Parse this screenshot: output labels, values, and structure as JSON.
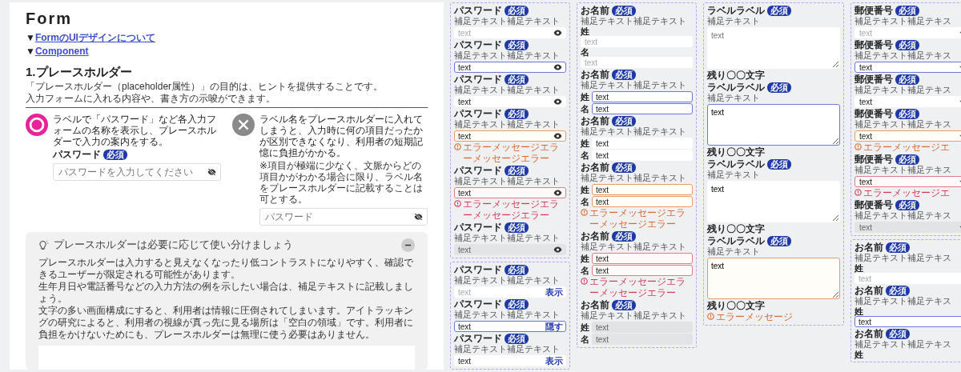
{
  "doc": {
    "title": "Form",
    "links": [
      {
        "marker": "▼",
        "label": "FormのUIデザインについて"
      },
      {
        "marker": "▼",
        "label": "Component"
      }
    ],
    "section_title": "1.プレースホルダー",
    "intro": [
      "「プレースホルダー（placeholder属性）」の目的は、ヒントを提供することです。",
      "入力フォームに入れる内容や、書き方の示唆ができます。"
    ],
    "examples": [
      {
        "kind": "good",
        "text": "ラベルで「パスワード」など各入力フォームの名称を表示し、プレースホルダーで入力の案内をする。",
        "field": {
          "label": "パスワード",
          "badge": "必須",
          "placeholder": "パスワードを入力してください"
        }
      },
      {
        "kind": "bad",
        "text": "ラベル名をプレースホルダーに入れてしまうと、入力時に何の項目だったかが区別できなくなり、利用者の短期記憶に負担がかかる。",
        "note": "※項目が極端に少なく、文脈からどの項目かがわかる場合に限り、ラベル名をプレースホルダーに記載することは可とする。",
        "field": {
          "placeholder": "パスワード"
        }
      }
    ],
    "tip": {
      "title": "プレースホルダーは必要に応じて使い分けましょう",
      "expanded": true,
      "paragraphs": [
        "プレースホルダーは入力すると見えなくなったり低コントラストになりやすく、確認できるユーザーが限定される可能性があります。",
        "生年月日や電話番号などの入力方法の例を示したい場合は、補足テキストに記載しましょう。",
        "文字の多い画面構成にすると、利用者は情報に圧倒されてしまいます。アイトラッキングの研究によると、利用者の視線が真っ先に見る場所は「空白の領域」です。利用者に負担をかけないためにも、プレースホルダーは無理に使う必要はありません。"
      ]
    }
  },
  "columns": [
    {
      "frames": [
        {
          "kind": "password",
          "items": [
            {
              "label": "パスワード",
              "badge": "必須",
              "help": "補足テキスト補足テキスト",
              "focused": false,
              "warning": false,
              "error": false,
              "disabled": false,
              "placeholder": "text"
            },
            {
              "label": "パスワード",
              "badge": "必須",
              "help": "補足テキスト補足テキスト",
              "focused": true,
              "warning": false,
              "error": false,
              "disabled": false,
              "value": "text"
            },
            {
              "label": "パスワード",
              "badge": "必須",
              "help": "補足テキスト補足テキスト",
              "focused": false,
              "warning": false,
              "error": false,
              "disabled": false,
              "value": "text"
            },
            {
              "label": "パスワード",
              "badge": "必須",
              "help": "補足テキスト補足テキスト",
              "focused": false,
              "warning": true,
              "error": false,
              "disabled": false,
              "value": "text",
              "message": "エラーメッセージエラーメッセージエラー"
            },
            {
              "label": "パスワード",
              "badge": "必須",
              "help": "補足テキスト補足テキスト",
              "focused": false,
              "warning": false,
              "error": true,
              "disabled": false,
              "value": "text",
              "message": "エラーメッセージエラーメッセージエラー"
            },
            {
              "label": "パスワード",
              "badge": "必須",
              "help": "補足テキスト補足テキスト",
              "focused": false,
              "warning": false,
              "error": false,
              "disabled": true,
              "value": "text"
            }
          ]
        },
        {
          "kind": "password_toggle",
          "items": [
            {
              "label": "パスワード",
              "badge": "必須",
              "help": "補足テキスト補足テキスト",
              "focused": false,
              "warning": false,
              "error": false,
              "disabled": false,
              "placeholder": "text",
              "toggle": "表示"
            },
            {
              "label": "パスワード",
              "badge": "必須",
              "help": "補足テキスト補足テキスト",
              "focused": true,
              "warning": false,
              "error": false,
              "disabled": false,
              "value": "text",
              "toggle": "隠す"
            },
            {
              "label": "パスワード",
              "badge": "必須",
              "help": "補足テキスト補足テキスト",
              "focused": false,
              "warning": false,
              "error": false,
              "disabled": false,
              "value": "text",
              "toggle": "表示"
            }
          ]
        }
      ]
    },
    {
      "frames": [
        {
          "kind": "name",
          "items": [
            {
              "label": "お名前",
              "badge": "必須",
              "help": "補足テキスト補足テキスト",
              "focused": false,
              "warning": false,
              "error": false,
              "disabled": false,
              "labels_on_top": true,
              "parts": [
                {
                  "label": "姓",
                  "placeholder": "text"
                },
                {
                  "label": "名",
                  "placeholder": "text"
                }
              ]
            },
            {
              "label": "お名前",
              "badge": "必須",
              "help": "補足テキスト補足テキスト",
              "focused": true,
              "warning": false,
              "error": false,
              "disabled": false,
              "labels_on_top": false,
              "parts": [
                {
                  "label": "姓",
                  "value": "text"
                },
                {
                  "label": "名",
                  "value": "text"
                }
              ]
            },
            {
              "label": "お名前",
              "badge": "必須",
              "help": "補足テキスト補足テキスト",
              "focused": false,
              "warning": false,
              "error": false,
              "disabled": false,
              "labels_on_top": false,
              "parts": [
                {
                  "label": "姓",
                  "value": "text"
                },
                {
                  "label": "名",
                  "value": "text"
                }
              ]
            },
            {
              "label": "お名前",
              "badge": "必須",
              "help": "補足テキスト補足テキスト",
              "focused": false,
              "warning": true,
              "error": false,
              "disabled": false,
              "labels_on_top": false,
              "parts": [
                {
                  "label": "姓",
                  "value": "text"
                },
                {
                  "label": "名",
                  "value": "text"
                }
              ],
              "message": "エラーメッセージエラーメッセージエラー"
            },
            {
              "label": "お名前",
              "badge": "必須",
              "help": "補足テキスト補足テキスト",
              "focused": false,
              "warning": false,
              "error": true,
              "disabled": false,
              "labels_on_top": false,
              "parts": [
                {
                  "label": "姓",
                  "value": "text"
                },
                {
                  "label": "名",
                  "value": "text"
                }
              ],
              "message": "エラーメッセージエラーメッセージエラー"
            },
            {
              "label": "お名前",
              "badge": "必須",
              "help": "補足テキスト補足テキスト",
              "focused": false,
              "warning": false,
              "error": false,
              "disabled": true,
              "labels_on_top": false,
              "parts": [
                {
                  "label": "姓",
                  "value": "text"
                },
                {
                  "label": "名",
                  "value": "text"
                }
              ]
            }
          ]
        }
      ]
    },
    {
      "frames": [
        {
          "kind": "textarea",
          "items": [
            {
              "label": "ラベルラベル",
              "badge": "必須",
              "help": "補足テキスト",
              "focused": false,
              "warning": false,
              "error": false,
              "disabled": false,
              "placeholder": "text",
              "counter": "残り〇〇文字"
            },
            {
              "label": "ラベルラベル",
              "badge": "必須",
              "help": "補足テキスト",
              "focused": true,
              "warning": false,
              "error": false,
              "disabled": false,
              "value": "text",
              "counter": "残り〇〇文字"
            },
            {
              "label": "ラベルラベル",
              "badge": "必須",
              "help": "補足テキスト",
              "focused": false,
              "warning": false,
              "error": false,
              "disabled": false,
              "value": "text",
              "counter": "残り〇〇文字"
            },
            {
              "label": "ラベルラベル",
              "badge": "必須",
              "help": "補足テキスト",
              "focused": false,
              "warning": true,
              "error": false,
              "disabled": false,
              "value": "text",
              "counter": "残り〇〇文字",
              "message": "エラーメッセージ"
            }
          ]
        }
      ]
    },
    {
      "frames": [
        {
          "kind": "select",
          "items": [
            {
              "label": "郵便番号",
              "badge": "必須",
              "help": "補足テキスト補足テキス",
              "focused": false,
              "warning": false,
              "error": false,
              "disabled": false,
              "placeholder": "text"
            },
            {
              "label": "郵便番号",
              "badge": "必須",
              "help": "補足テキスト補足テキス",
              "focused": true,
              "warning": false,
              "error": false,
              "disabled": false,
              "value": "text"
            },
            {
              "label": "郵便番号",
              "badge": "必須",
              "help": "補足テキスト補足テキス",
              "focused": false,
              "warning": false,
              "error": false,
              "disabled": false,
              "value": "text"
            },
            {
              "label": "郵便番号",
              "badge": "必須",
              "help": "補足テキスト補足テキス",
              "focused": false,
              "warning": true,
              "error": false,
              "disabled": false,
              "value": "text",
              "message": "エラーメッセージエ"
            },
            {
              "label": "郵便番号",
              "badge": "必須",
              "help": "補足テキスト補足テキス",
              "focused": false,
              "warning": false,
              "error": true,
              "disabled": false,
              "value": "text",
              "message": "エラーメッセージエ"
            },
            {
              "label": "郵便番号",
              "badge": "必須",
              "help": "補足テキスト補足テキス",
              "focused": false,
              "warning": false,
              "error": false,
              "disabled": true,
              "value": "text"
            }
          ]
        },
        {
          "kind": "name",
          "items": [
            {
              "label": "お名前",
              "badge": "必須",
              "help": "補足テキスト補足テキス",
              "focused": false,
              "warning": false,
              "error": false,
              "disabled": false,
              "labels_on_top": true,
              "parts": [
                {
                  "label": "姓",
                  "placeholder": "text"
                }
              ]
            },
            {
              "label": "お名前",
              "badge": "必須",
              "help": "補足テキスト補足テキス",
              "focused": true,
              "warning": false,
              "error": false,
              "disabled": false,
              "labels_on_top": true,
              "parts": [
                {
                  "label": "姓",
                  "value": "text"
                }
              ]
            },
            {
              "label": "お名前",
              "badge": "必須",
              "help": "補足テキスト補足テキス",
              "labels_on_top": true,
              "parts": [
                {
                  "label": "姓"
                }
              ]
            }
          ]
        }
      ]
    }
  ]
}
